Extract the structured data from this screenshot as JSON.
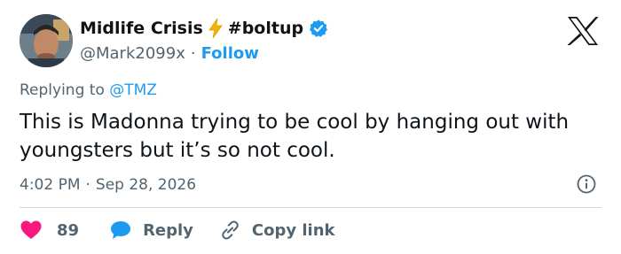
{
  "author": {
    "display_name": "Midlife Crisis",
    "name_emoji": "bolt-emoji",
    "hashtag": "#boltup",
    "handle": "@Mark2099x",
    "separator": "·",
    "follow_label": "Follow",
    "verified": true
  },
  "reply_to": {
    "prefix": "Replying to",
    "mention": "@TMZ"
  },
  "tweet": {
    "text": "This is Madonna trying to be cool by hanging out with youngsters but it’s so not cool."
  },
  "meta": {
    "time": "4:02 PM",
    "separator": "·",
    "date": "Sep 28, 2026"
  },
  "actions": {
    "like_count": "89",
    "reply_label": "Reply",
    "copy_link_label": "Copy link"
  },
  "colors": {
    "accent": "#1d9bf0",
    "like": "#f91880",
    "text": "#0f1419",
    "muted": "#536471"
  },
  "icons": [
    "x-logo-icon",
    "verified-badge-icon",
    "info-icon",
    "heart-icon",
    "reply-bubble-icon",
    "link-icon",
    "bolt-icon"
  ]
}
